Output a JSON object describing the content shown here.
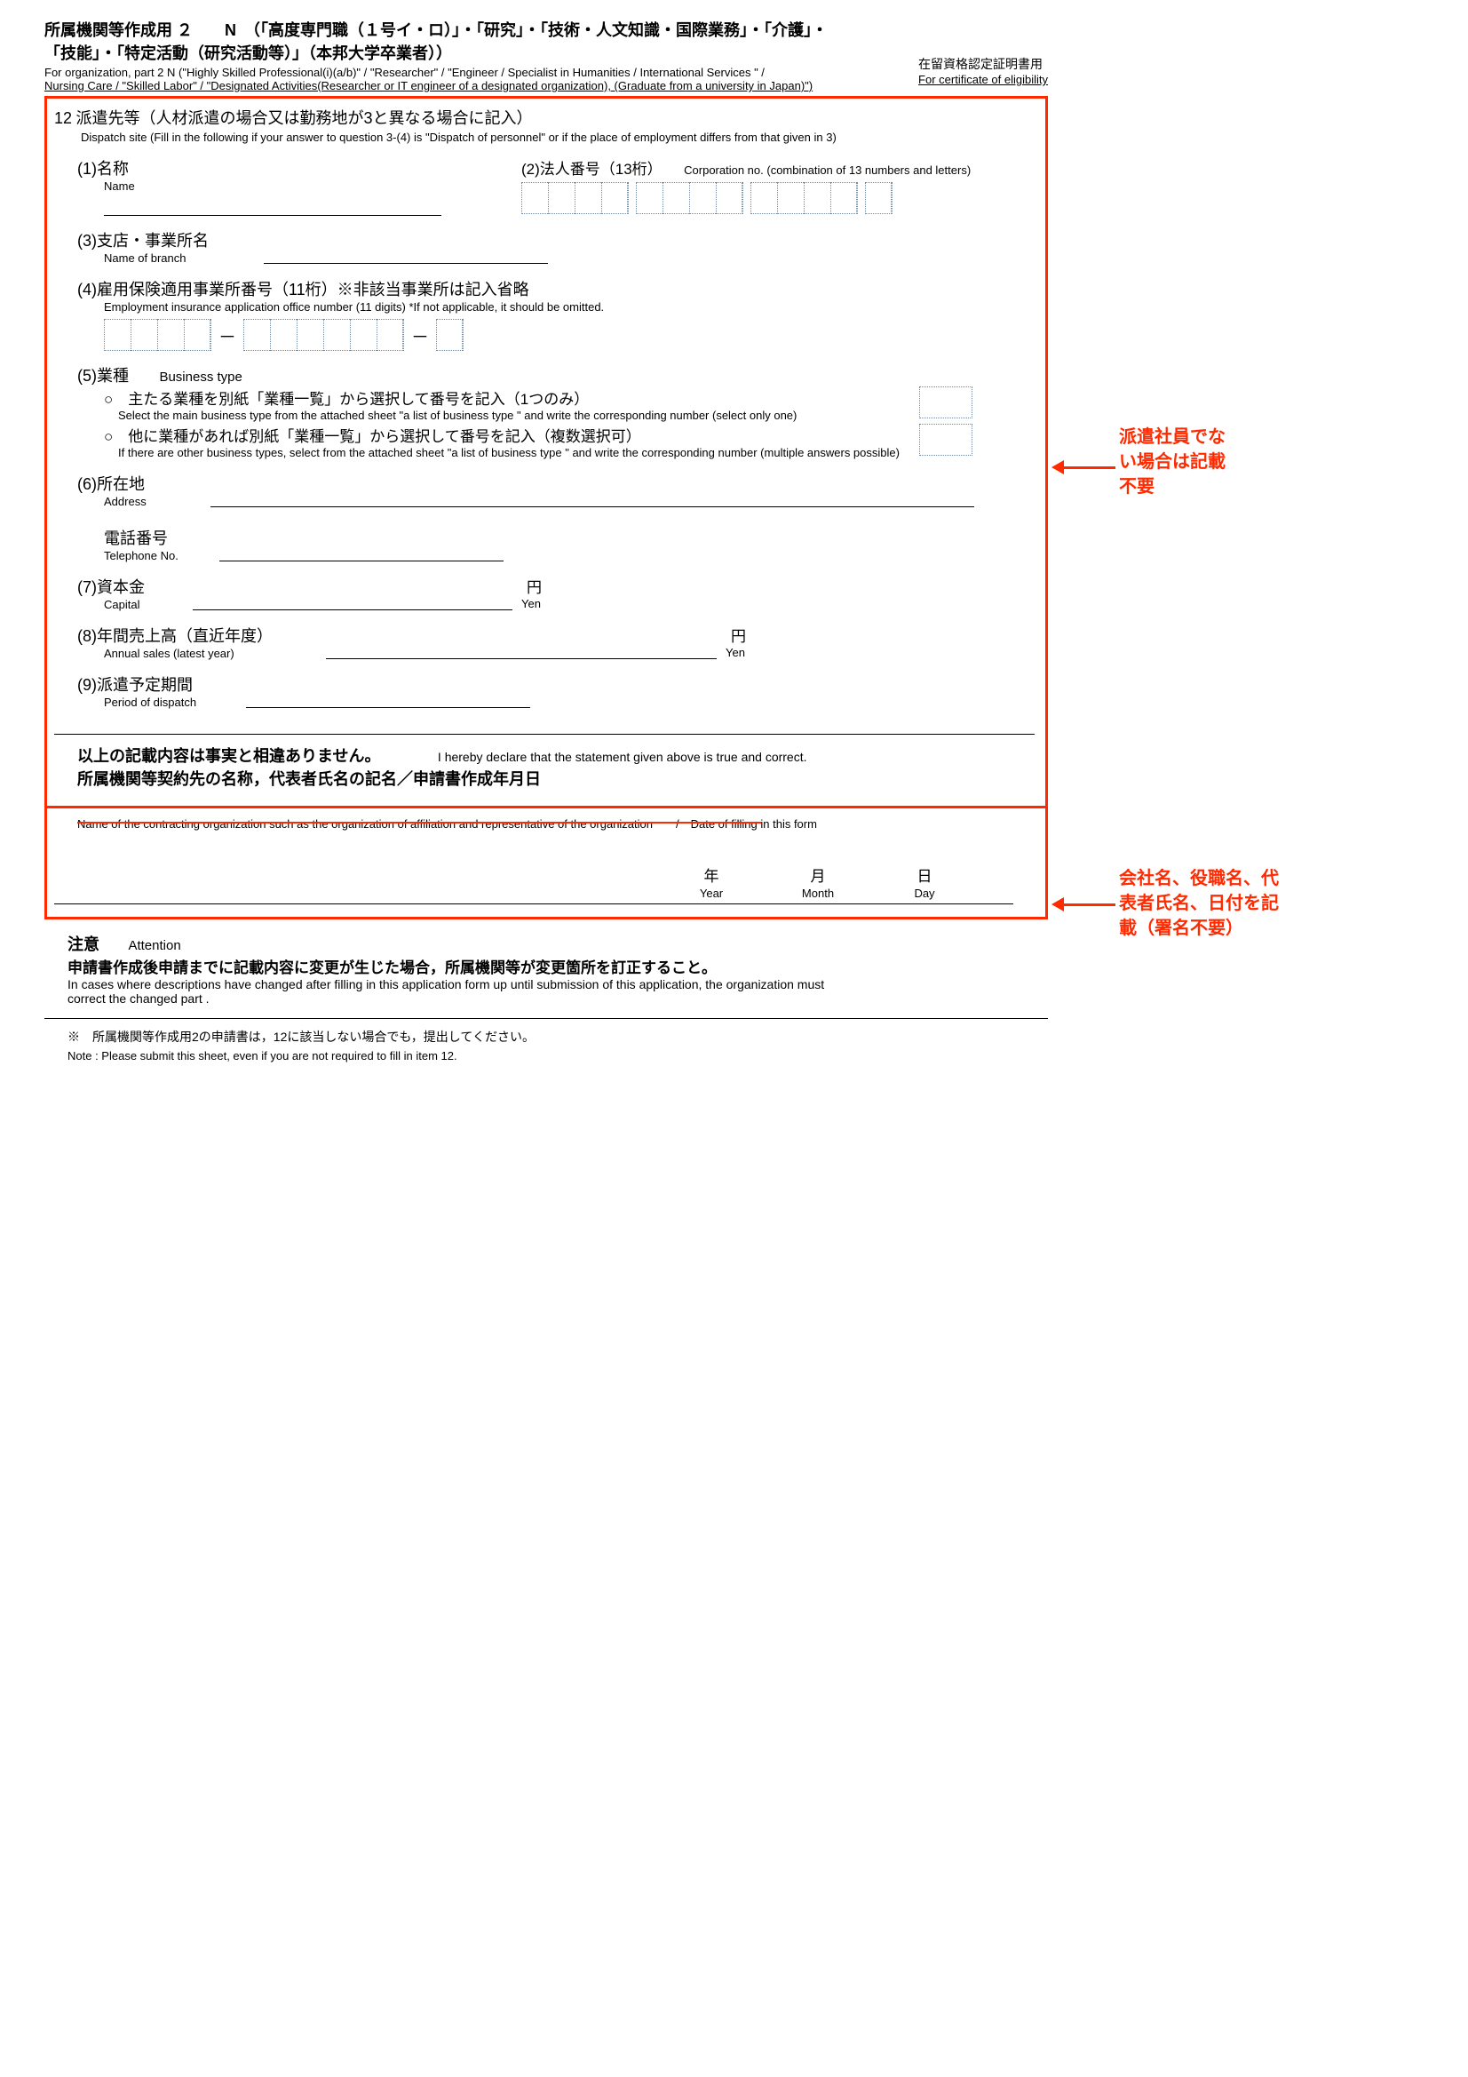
{
  "header": {
    "line1": "所属機関等作成用 ２　　N　（「高度専門職（１号イ・ロ）」・「研究」・「技術・人文知識・国際業務」・「介護」・",
    "line2": "「技能」・「特定活動（研究活動等）」（本邦大学卒業者））",
    "en1": "For organization, part 2  N (\"Highly Skilled Professional(i)(a/b)\" / \"Researcher\" / \"Engineer /  Specialist in Humanities  / International Services \" /",
    "en2": "Nursing Care /  \"Skilled Labor\" / \"Designated Activities(Researcher or IT engineer of a designated organization), (Graduate from a university in Japan)\")",
    "right_jp": "在留資格認定証明書用",
    "right_en": "For certificate of eligibility"
  },
  "section12": {
    "num": "12",
    "title_jp": "派遣先等（人材派遣の場合又は勤務地が3と異なる場合に記入）",
    "title_en": "Dispatch site (Fill in the following if your answer to question 3-(4) is \"Dispatch of personnel\" or if the place of employment differs from that given in 3)",
    "i1_jp": "(1)名称",
    "i1_en": "Name",
    "i2_jp": "(2)法人番号（13桁）",
    "i2_en": "Corporation no. (combination of 13 numbers and letters)",
    "i3_jp": "(3)支店・事業所名",
    "i3_en": "Name of branch",
    "i4_jp": "(4)雇用保険適用事業所番号（11桁）※非該当事業所は記入省略",
    "i4_en": "Employment insurance application office number (11 digits) *If not applicable, it should be omitted.",
    "i5_jp": "(5)業種",
    "i5_en": "Business type",
    "i5_a_jp": "○　主たる業種を別紙「業種一覧」から選択して番号を記入（1つのみ）",
    "i5_a_en": "Select the main business type from the attached sheet \"a list of business type \" and write the corresponding number (select only one)",
    "i5_b_jp": "○　他に業種があれば別紙「業種一覧」から選択して番号を記入（複数選択可）",
    "i5_b_en": "If there are other business types, select from the attached sheet \"a list of business type \" and write the corresponding number (multiple answers possible)",
    "i6_jp": "(6)所在地",
    "i6_en": "Address",
    "i6b_jp": "電話番号",
    "i6b_en": "Telephone No.",
    "i7_jp": "(7)資本金",
    "i7_en": "Capital",
    "yen_jp": "円",
    "yen_en": "Yen",
    "i8_jp": "(8)年間売上高（直近年度）",
    "i8_en": "Annual sales (latest year)",
    "i9_jp": "(9)派遣予定期間",
    "i9_en": "Period of dispatch"
  },
  "declaration": {
    "line1_jp": "以上の記載内容は事実と相違ありません。",
    "line1_en": "I hereby declare that the statement given above is true and correct.",
    "line2_jp": "所属機関等契約先の名称，代表者氏名の記名／申請書作成年月日",
    "line2_en": "Name of the contracting organization such as the organization of affiliation and representative of the organization　　/　Date of filling in this form"
  },
  "date": {
    "year_jp": "年",
    "year_en": "Year",
    "month_jp": "月",
    "month_en": "Month",
    "day_jp": "日",
    "day_en": "Day"
  },
  "attention": {
    "label_jp": "注意",
    "label_en": "Attention",
    "body_jp": "申請書作成後申請までに記載内容に変更が生じた場合，所属機関等が変更箇所を訂正すること。",
    "body_en1": "In cases where descriptions have changed after filling in this application form up until submission of this application,  the organization must",
    "body_en2": "correct the changed part ."
  },
  "footnote": {
    "jp": "※　所属機関等作成用2の申請書は，12に該当しない場合でも，提出してください。",
    "en": "Note : Please submit this sheet, even if you are not required to fill in item 12."
  },
  "annotations": {
    "a1_l1": "派遣社員でな",
    "a1_l2": "い場合は記載",
    "a1_l3": "不要",
    "a2_l1": "会社名、役職名、代",
    "a2_l2": "表者氏名、日付を記",
    "a2_l3": "載（署名不要）"
  }
}
